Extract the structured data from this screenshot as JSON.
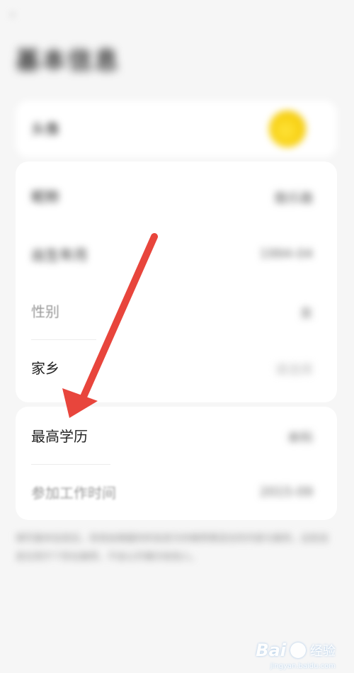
{
  "header": {
    "title": "基本信息",
    "back_icon": "chevron-left-icon"
  },
  "avatar_row": {
    "label": "头像"
  },
  "main": {
    "rows": [
      {
        "label": "昵称",
        "value": "酷乐趣"
      },
      {
        "label": "出生年月",
        "value": "1994-04"
      },
      {
        "label": "性别",
        "value": "女"
      },
      {
        "label": "家乡",
        "value": "请选择"
      }
    ]
  },
  "education": {
    "rows": [
      {
        "label": "最高学历",
        "value": "本科"
      },
      {
        "label": "参加工作时间",
        "value": "2015-09"
      }
    ]
  },
  "footnote": "填写基本信息后，系统会根据你的信息为你推荐更适合的内容与服务，这些信息仅用于个性化推荐，不会公开展示给他人。",
  "watermark": {
    "brand": "Bai",
    "suffix": "经验",
    "url": "jingyan.baidu.com"
  },
  "colors": {
    "arrow": "#e8453c",
    "avatar": "#f7cf10",
    "background": "#f6f6f6"
  }
}
